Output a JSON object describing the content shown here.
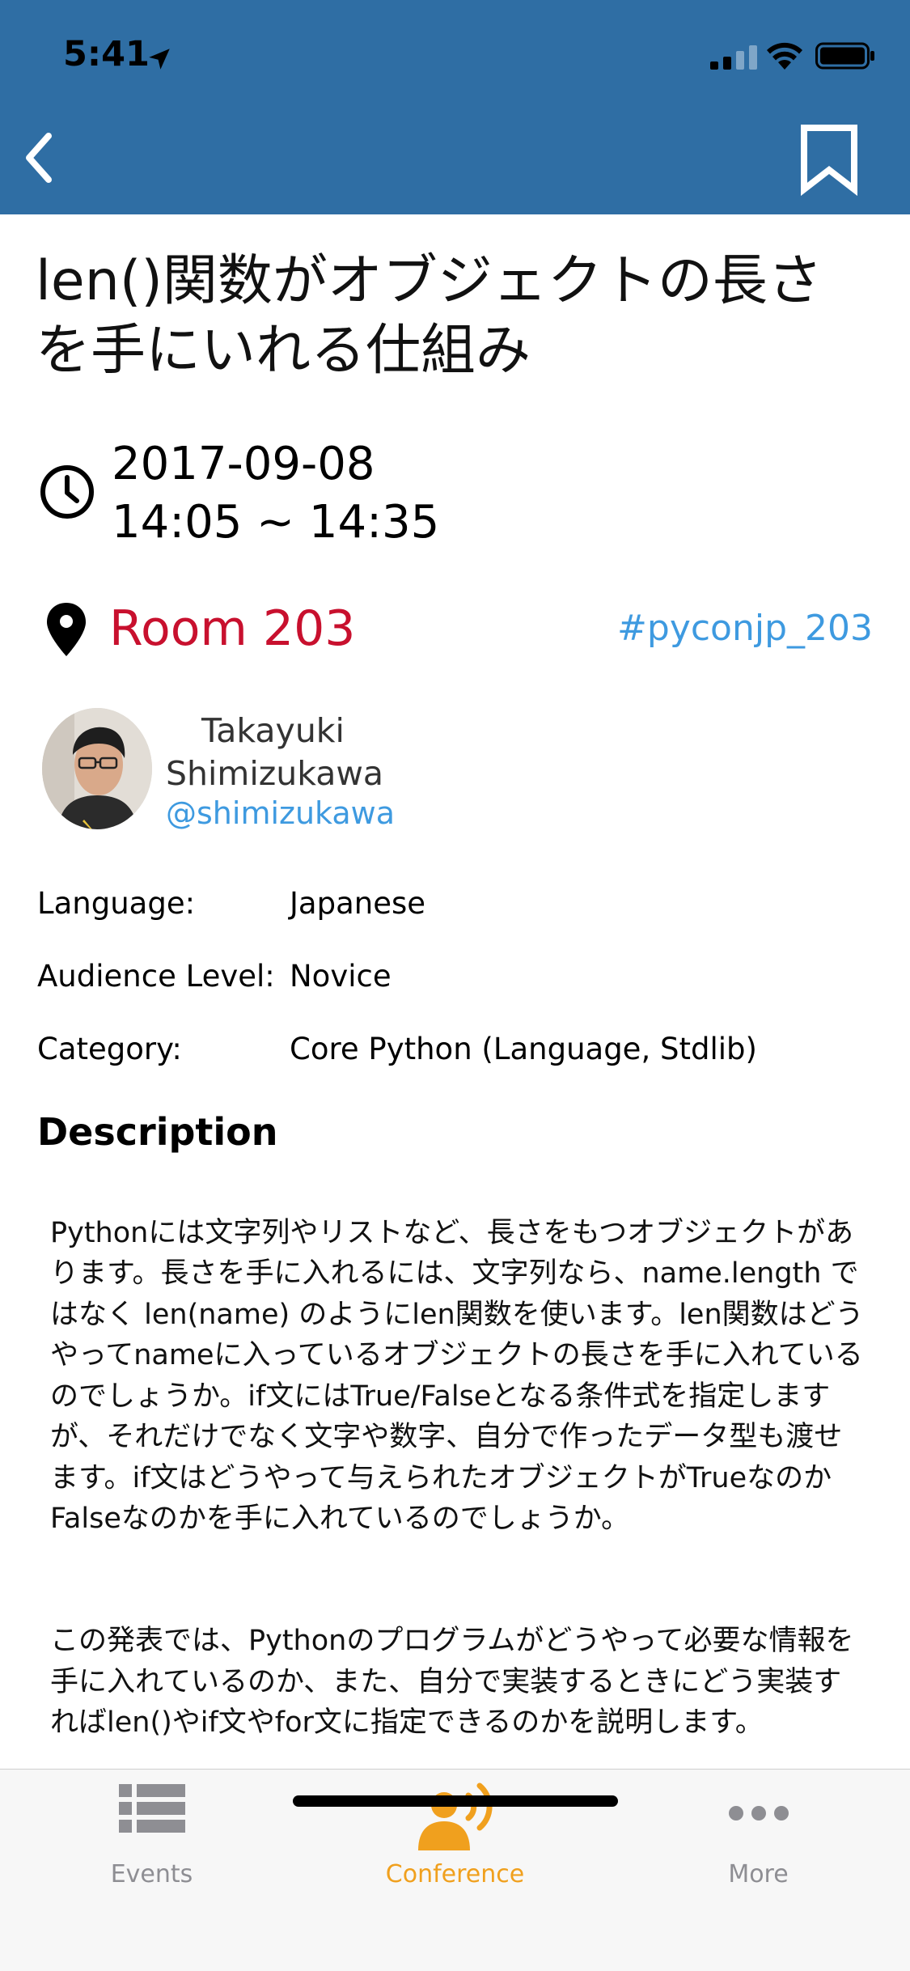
{
  "status_bar": {
    "time": "5:41"
  },
  "session": {
    "title": "len()関数がオブジェクトの長さを手にいれる仕組み",
    "date": "2017-09-08",
    "time_range": "14:05 ~ 14:35",
    "room": "Room 203",
    "hashtag": "#pyconjp_203"
  },
  "speaker": {
    "name": "Takayuki Shimizukawa",
    "handle": "@shimizukawa"
  },
  "details": [
    {
      "label": "Language:",
      "value": "Japanese"
    },
    {
      "label": "Audience Level:",
      "value": "Novice"
    },
    {
      "label": "Category:",
      "value": "Core Python (Language, Stdlib)"
    }
  ],
  "description": {
    "heading": "Description",
    "paragraph1": "Pythonには文字列やリストなど、長さをもつオブジェクトがあります。長さを手に入れるには、文字列なら、name.length ではなく len(name) のようにlen関数を使います。len関数はどうやってnameに入っているオブジェクトの長さを手に入れているのでしょうか。if文にはTrue/Falseとなる条件式を指定しますが、それだけでなく文字や数字、自分で作ったデータ型も渡せます。if文はどうやって与えられたオブジェクトがTrueなのかFalseなのかを手に入れているのでしょうか。",
    "paragraph2": "この発表では、Pythonのプログラムがどうやって必要な情報を手に入れているのか、また、自分で実装するときにどう実装すればlen()やif文やfor文に指定できるのかを説明します。"
  },
  "tabs": [
    {
      "label": "Events",
      "icon": "list-icon",
      "active": false
    },
    {
      "label": "Conference",
      "icon": "speaker-icon",
      "active": true
    },
    {
      "label": "More",
      "icon": "more-icon",
      "active": false
    }
  ],
  "colors": {
    "header": "#2f6ea4",
    "room": "#c8102e",
    "link": "#3e9ae0",
    "tab_active": "#f0a01e",
    "tab_inactive": "#8e8e93"
  }
}
